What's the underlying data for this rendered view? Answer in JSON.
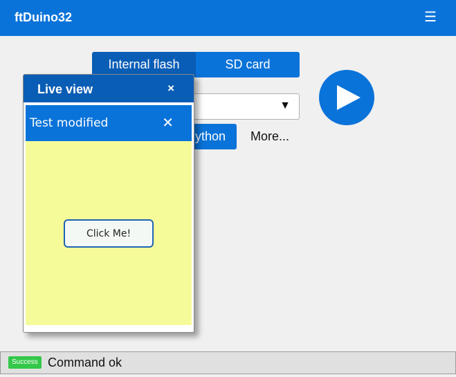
{
  "app": {
    "title": "ftDuino32",
    "menu_icon": "☰"
  },
  "storage": {
    "options": [
      "Internal flash",
      "SD card"
    ],
    "active": "Internal flash"
  },
  "file_select": {
    "arrow": "▼"
  },
  "actions": {
    "python_label": "ython",
    "more_label": "More..."
  },
  "run": {
    "icon": "play-icon"
  },
  "live_view": {
    "title": "Live view",
    "close": "×",
    "panel": {
      "title": "Test modified",
      "close": "✕",
      "button_label": "Click Me!",
      "background": "#f6fb9a"
    }
  },
  "status": {
    "badge": "Success",
    "message": "Command ok",
    "badge_color": "#34c84a"
  },
  "colors": {
    "primary": "#0a73d9",
    "primary_dark": "#0a5db5"
  }
}
